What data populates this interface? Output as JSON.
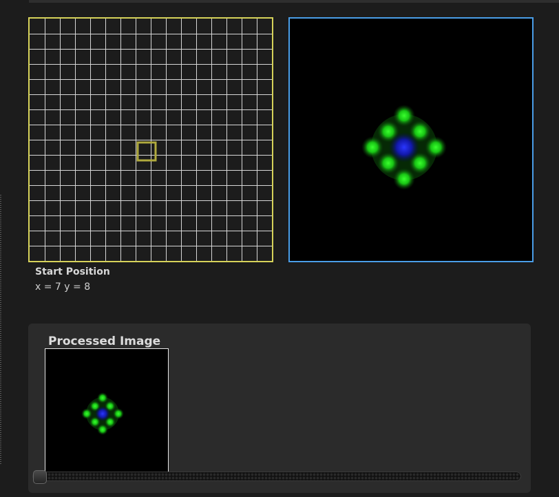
{
  "grid": {
    "columns": 16,
    "rows": 16,
    "selected_cell": {
      "col": 7,
      "row": 8
    }
  },
  "start_position": {
    "label": "Start Position",
    "coords": "x = 7 y = 8"
  },
  "processed_image": {
    "title": "Processed Image"
  },
  "slider": {
    "value": 0
  },
  "colors": {
    "grid_border": "#d7d35a",
    "grid_lines": "#d8d8d8",
    "selected_cell": "#b0aa3e",
    "result_border": "#4a9ee8",
    "glow_green": "#22d41e",
    "glow_blue": "#1a24ff"
  }
}
